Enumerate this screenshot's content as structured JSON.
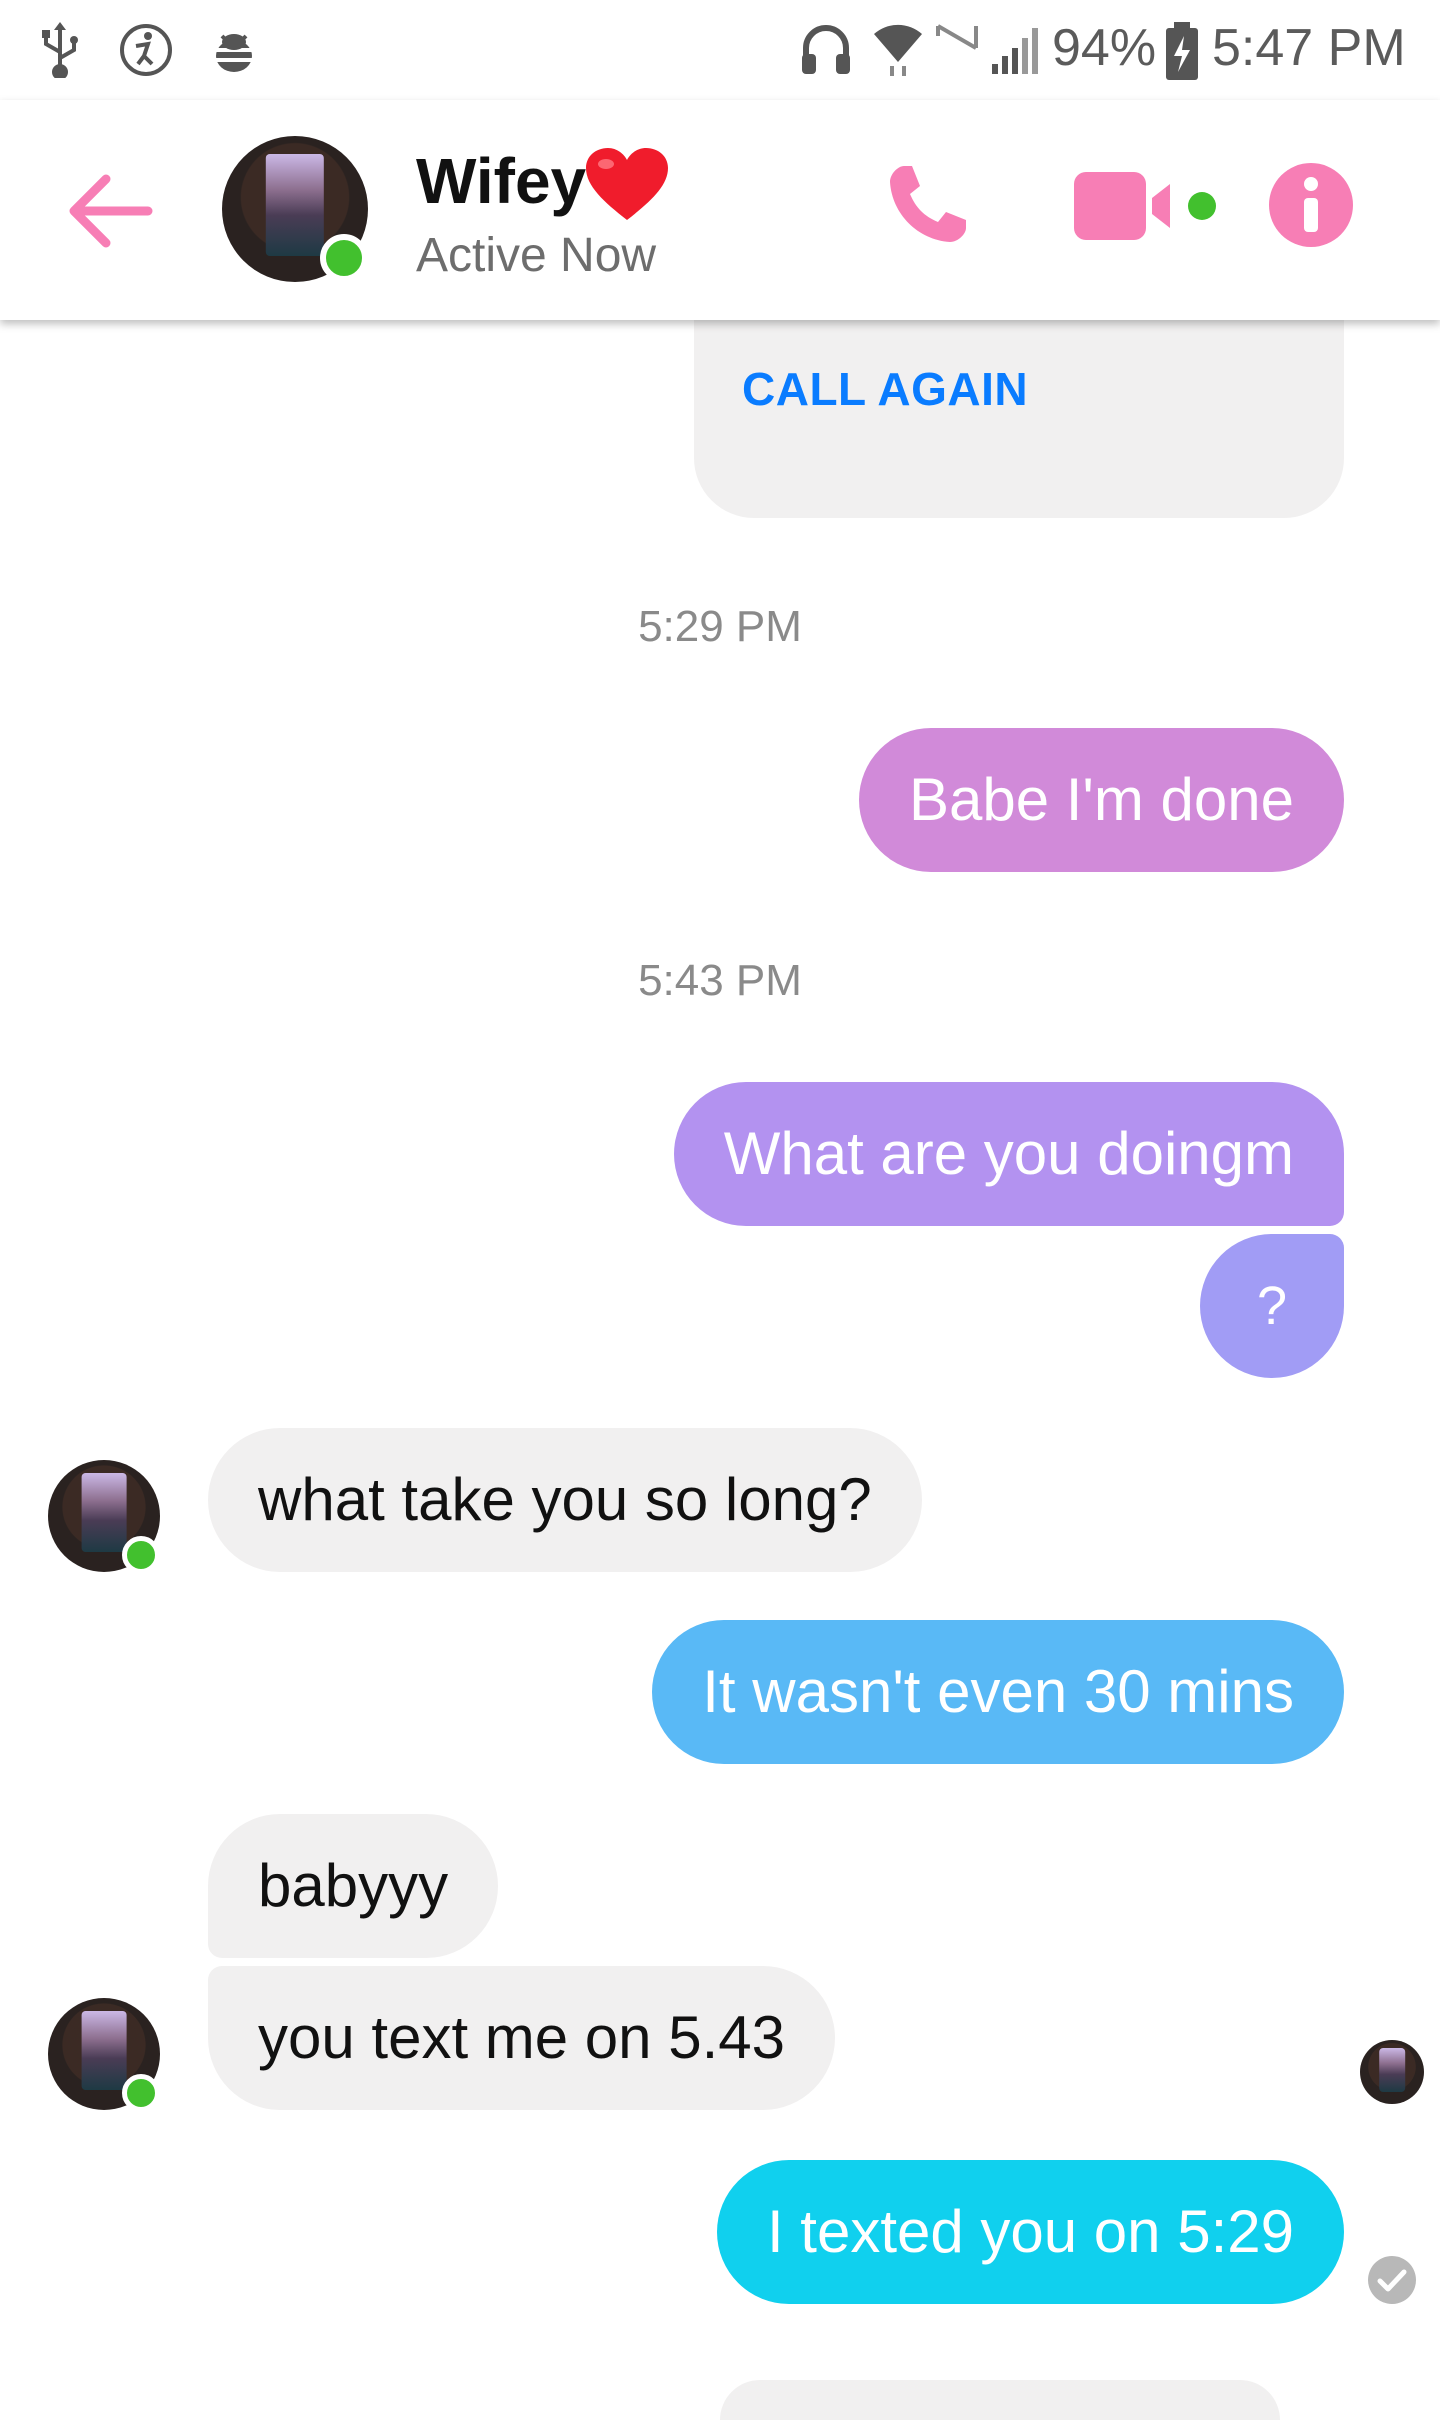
{
  "status_bar": {
    "battery": "94%",
    "time": "5:47 PM"
  },
  "header": {
    "contact_name": "Wifey",
    "status": "Active Now"
  },
  "call_card": {
    "action_label": "CALL AGAIN"
  },
  "colors": {
    "accent": "#f77eb5",
    "online": "#42c02e",
    "link": "#0a7cff"
  },
  "messages": [
    {
      "type": "timestamp",
      "text": "5:29 PM"
    },
    {
      "type": "outgoing",
      "text": "Babe I'm done",
      "color": "#d18ad9"
    },
    {
      "type": "timestamp",
      "text": "5:43 PM"
    },
    {
      "type": "outgoing",
      "text": "What are you doingm",
      "color": "#b392f0"
    },
    {
      "type": "outgoing",
      "text": "?",
      "color": "#a19cf5"
    },
    {
      "type": "incoming",
      "text": "what take you so long?"
    },
    {
      "type": "outgoing",
      "text": "It wasn't even 30 mins",
      "color": "#59b9f6"
    },
    {
      "type": "incoming",
      "text": "babyyy"
    },
    {
      "type": "incoming",
      "text": "you text me on 5.43"
    },
    {
      "type": "outgoing",
      "text": "I texted you on 5:29",
      "color": "#10d0ee"
    }
  ]
}
